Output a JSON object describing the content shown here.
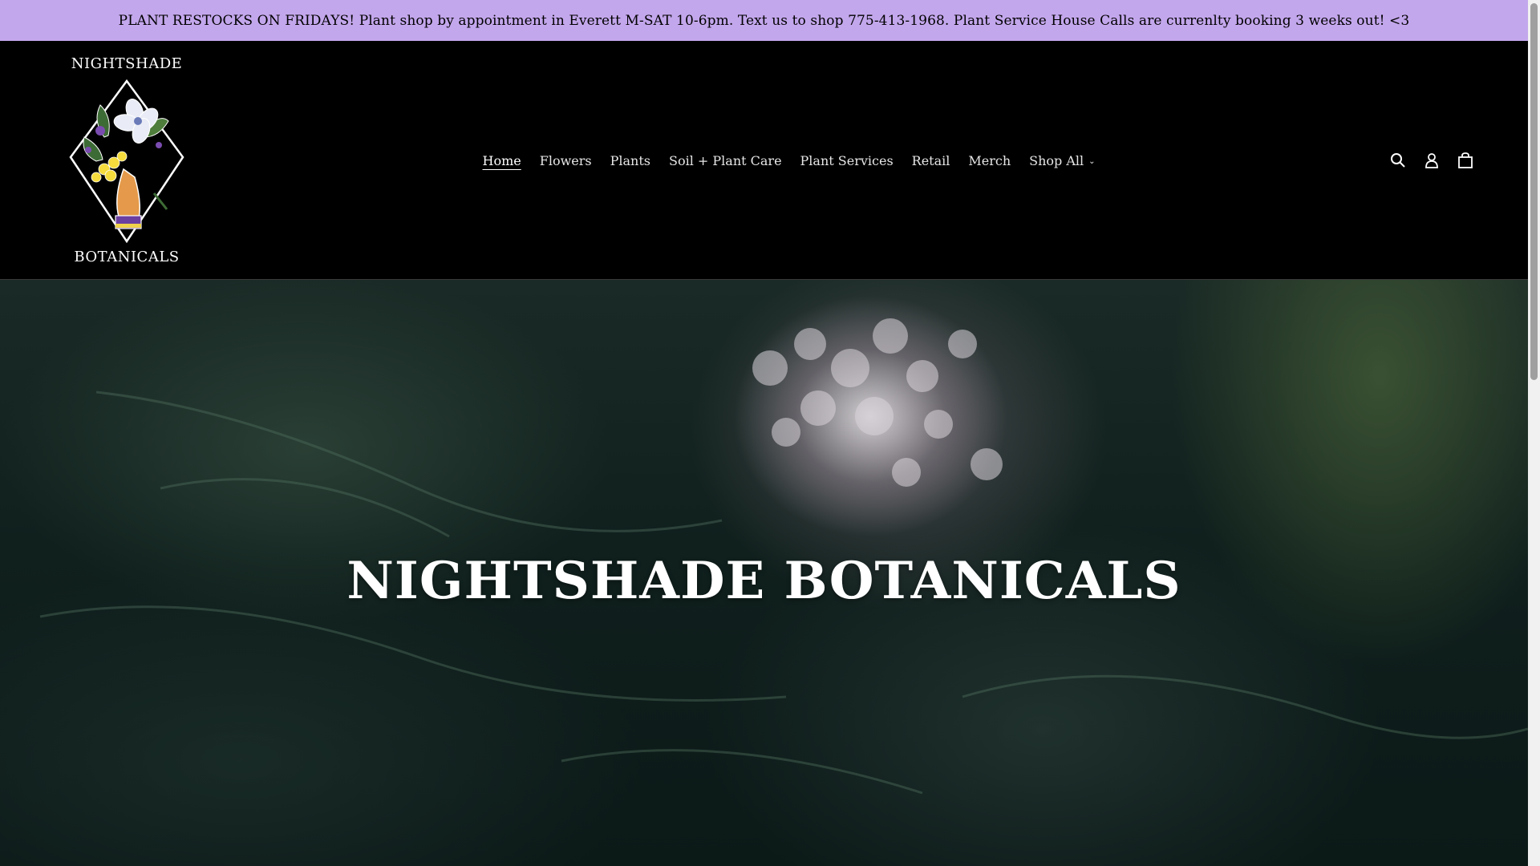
{
  "announcement": {
    "text": "PLANT RESTOCKS ON FRIDAYS! Plant shop by appointment in Everett M-SAT 10-6pm. Text us to shop 775-413-1968. Plant Service House Calls are currenlty booking 3 weeks out! <3"
  },
  "header": {
    "logo": {
      "top_text": "NIGHTSHADE",
      "bottom_text": "BOTANICALS"
    },
    "nav": [
      {
        "label": "Home",
        "active": true
      },
      {
        "label": "Flowers"
      },
      {
        "label": "Plants"
      },
      {
        "label": "Soil + Plant Care"
      },
      {
        "label": "Plant Services"
      },
      {
        "label": "Retail"
      },
      {
        "label": "Merch"
      },
      {
        "label": "Shop All",
        "has_dropdown": true
      }
    ],
    "icons": [
      "search-icon",
      "account-icon",
      "cart-icon"
    ]
  },
  "hero": {
    "title": "NIGHTSHADE BOTANICALS"
  },
  "colors": {
    "announcement_bg": "#c3a7ec",
    "header_bg": "#000000",
    "hero_bg": "#12221f"
  }
}
